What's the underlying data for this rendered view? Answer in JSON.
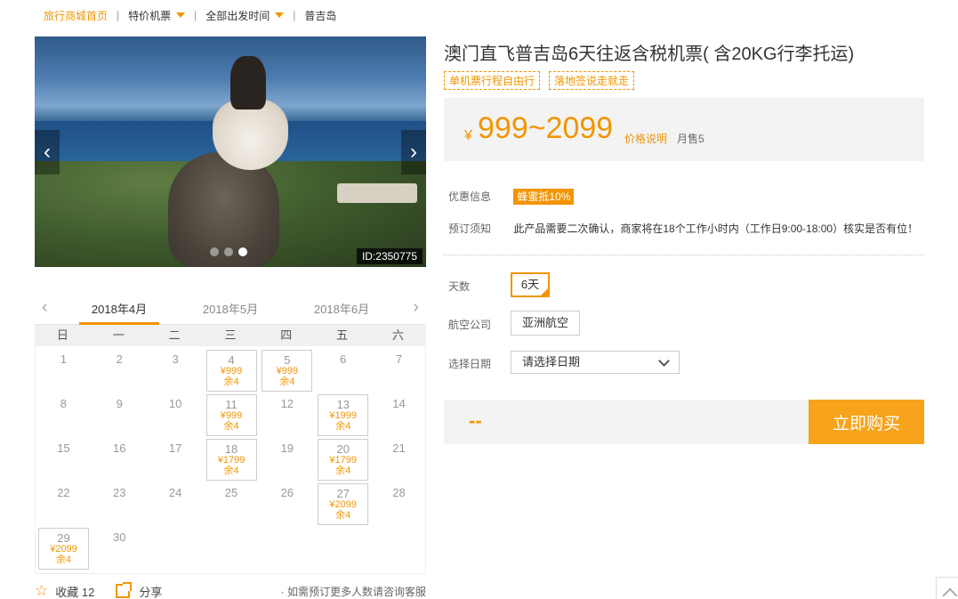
{
  "breadcrumb": {
    "home": "旅行商城首页",
    "cat": "特价机票",
    "time": "全部出发时间",
    "place": "普吉岛"
  },
  "gallery": {
    "id_tag": "ID:2350775",
    "prev": "‹",
    "next": "›",
    "slide_count": 3,
    "active_slide": 3
  },
  "calendar": {
    "prev": "‹",
    "next": "›",
    "months": [
      "2018年4月",
      "2018年5月",
      "2018年6月"
    ],
    "active_month": "2018年4月",
    "weekdays": [
      "日",
      "一",
      "二",
      "三",
      "四",
      "五",
      "六"
    ],
    "lead_blank": 0,
    "days": [
      {
        "d": "1"
      },
      {
        "d": "2"
      },
      {
        "d": "3"
      },
      {
        "d": "4",
        "price": "¥999",
        "left": "余4"
      },
      {
        "d": "5",
        "price": "¥999",
        "left": "余4"
      },
      {
        "d": "6"
      },
      {
        "d": "7"
      },
      {
        "d": "8"
      },
      {
        "d": "9"
      },
      {
        "d": "10"
      },
      {
        "d": "11",
        "price": "¥999",
        "left": "余4"
      },
      {
        "d": "12"
      },
      {
        "d": "13",
        "price": "¥1999",
        "left": "余4"
      },
      {
        "d": "14"
      },
      {
        "d": "15"
      },
      {
        "d": "16"
      },
      {
        "d": "17"
      },
      {
        "d": "18",
        "price": "¥1799",
        "left": "余4"
      },
      {
        "d": "19"
      },
      {
        "d": "20",
        "price": "¥1799",
        "left": "余4"
      },
      {
        "d": "21"
      },
      {
        "d": "22"
      },
      {
        "d": "23"
      },
      {
        "d": "24"
      },
      {
        "d": "25"
      },
      {
        "d": "26"
      },
      {
        "d": "27",
        "price": "¥2099",
        "left": "余4"
      },
      {
        "d": "28"
      },
      {
        "d": "29",
        "price": "¥2099",
        "left": "余4"
      },
      {
        "d": "30"
      }
    ]
  },
  "footer": {
    "star": "☆",
    "fav": "收藏 12",
    "share": "分享",
    "note": "· 如需预订更多人数请咨询客服"
  },
  "product": {
    "title": "澳门直飞普吉岛6天往返含税机票( 含20KG行李托运)",
    "tags": [
      "单机票行程自由行",
      "落地签说走就走"
    ],
    "yen": "¥",
    "price_range": "999~2099",
    "price_explain": "价格说明",
    "monthly_sales": "月售5",
    "promo_label": "优惠信息",
    "promo_value": "蜂蜜抵10%",
    "notice_label": "预订须知",
    "notice_text": "此产品需要二次确认，商家将在18个工作小时内（工作日9:00-18:00）核实是否有位！",
    "days_label": "天数",
    "days_value": "6天",
    "airline_label": "航空公司",
    "airline_value": "亚洲航空",
    "date_label": "选择日期",
    "date_placeholder": "请选择日期",
    "total": "--",
    "buy": "立即购买"
  },
  "colors": {
    "accent": "#f29500",
    "button": "#f7a31b",
    "panel": "#f3f3f3"
  }
}
